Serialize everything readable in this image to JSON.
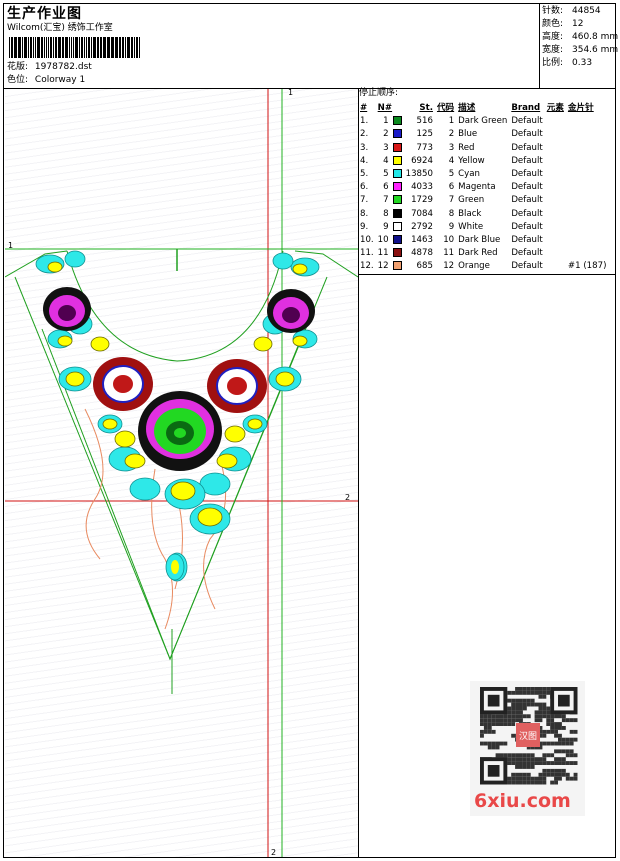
{
  "header": {
    "title": "生产作业图",
    "company": "Wilcom(汇宝) 绣饰工作室",
    "design_label": "花版:",
    "design_value": "1978782.dst",
    "colorway_label": "色位:",
    "colorway_value": "Colorway 1"
  },
  "stats": [
    {
      "label": "针数:",
      "value": "44854"
    },
    {
      "label": "颜色:",
      "value": "12"
    },
    {
      "label": "高度:",
      "value": "460.8 mm"
    },
    {
      "label": "宽度:",
      "value": "354.6 mm"
    },
    {
      "label": "比例:",
      "value": "0.33"
    }
  ],
  "stop_sequence_label": "停止顺序:",
  "table_headers": [
    "#",
    "N#",
    "St.",
    "代码",
    "描述",
    "Brand",
    "元素",
    "金片针"
  ],
  "rows": [
    {
      "idx": "1.",
      "n": "1",
      "st": "516",
      "code": "1",
      "desc": "Dark Green",
      "brand": "Default",
      "extra": "",
      "color": "#0a8a1e"
    },
    {
      "idx": "2.",
      "n": "2",
      "st": "125",
      "code": "2",
      "desc": "Blue",
      "brand": "Default",
      "extra": "",
      "color": "#1a1ac8"
    },
    {
      "idx": "3.",
      "n": "3",
      "st": "773",
      "code": "3",
      "desc": "Red",
      "brand": "Default",
      "extra": "",
      "color": "#d81818"
    },
    {
      "idx": "4.",
      "n": "4",
      "st": "6924",
      "code": "4",
      "desc": "Yellow",
      "brand": "Default",
      "extra": "",
      "color": "#ffff00"
    },
    {
      "idx": "5.",
      "n": "5",
      "st": "13850",
      "code": "5",
      "desc": "Cyan",
      "brand": "Default",
      "extra": "",
      "color": "#22e8e8"
    },
    {
      "idx": "6.",
      "n": "6",
      "st": "4033",
      "code": "6",
      "desc": "Magenta",
      "brand": "Default",
      "extra": "",
      "color": "#ff22ff"
    },
    {
      "idx": "7.",
      "n": "7",
      "st": "1729",
      "code": "7",
      "desc": "Green",
      "brand": "Default",
      "extra": "",
      "color": "#22d822"
    },
    {
      "idx": "8.",
      "n": "8",
      "st": "7084",
      "code": "8",
      "desc": "Black",
      "brand": "Default",
      "extra": "",
      "color": "#000000"
    },
    {
      "idx": "9.",
      "n": "9",
      "st": "2792",
      "code": "9",
      "desc": "White",
      "brand": "Default",
      "extra": "",
      "color": "#ffffff"
    },
    {
      "idx": "10.",
      "n": "10",
      "st": "1463",
      "code": "10",
      "desc": "Dark Blue",
      "brand": "Default",
      "extra": "",
      "color": "#10108a"
    },
    {
      "idx": "11.",
      "n": "11",
      "st": "4878",
      "code": "11",
      "desc": "Dark Red",
      "brand": "Default",
      "extra": "",
      "color": "#8a1010"
    },
    {
      "idx": "12.",
      "n": "12",
      "st": "685",
      "code": "12",
      "desc": "Orange",
      "brand": "Default",
      "extra": "#1 (187)",
      "color": "#f0a070"
    }
  ],
  "marks": {
    "one": "1",
    "two": "2"
  },
  "watermark": "6xiu.com",
  "seal_text": "汉图"
}
